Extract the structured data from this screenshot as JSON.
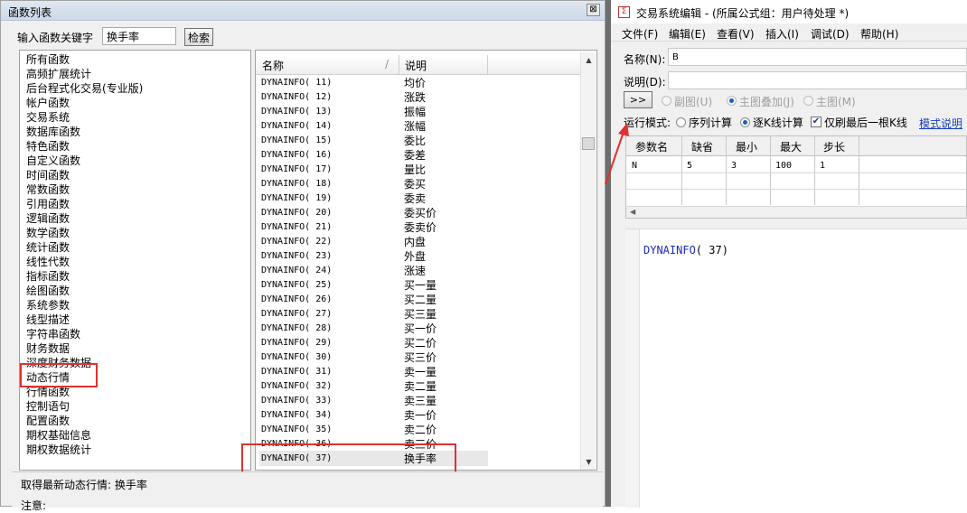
{
  "left": {
    "title": "函数列表",
    "close_label": "⊠",
    "search": {
      "label": "输入函数关键字",
      "value": "换手率",
      "button": "检索"
    },
    "categories": [
      "所有函数",
      "高频扩展统计",
      "后台程式化交易(专业版)",
      "帐户函数",
      "交易系统",
      "数据库函数",
      "特色函数",
      "自定义函数",
      "时间函数",
      "常数函数",
      "引用函数",
      "逻辑函数",
      "数学函数",
      "统计函数",
      "线性代数",
      "指标函数",
      "绘图函数",
      "系统参数",
      "线型描述",
      "字符串函数",
      "财务数据",
      "深度财务数据",
      "动态行情",
      "行情函数",
      "控制语句",
      "配置函数",
      "期权基础信息",
      "期权数据统计"
    ],
    "table": {
      "headers": {
        "name": "名称",
        "sort": "/",
        "desc": "说明"
      },
      "rows": [
        {
          "name": "DYNAINFO( 11)",
          "desc": "均价"
        },
        {
          "name": "DYNAINFO( 12)",
          "desc": "涨跌"
        },
        {
          "name": "DYNAINFO( 13)",
          "desc": "振幅"
        },
        {
          "name": "DYNAINFO( 14)",
          "desc": "涨幅"
        },
        {
          "name": "DYNAINFO( 15)",
          "desc": "委比"
        },
        {
          "name": "DYNAINFO( 16)",
          "desc": "委差"
        },
        {
          "name": "DYNAINFO( 17)",
          "desc": "量比"
        },
        {
          "name": "DYNAINFO( 18)",
          "desc": "委买"
        },
        {
          "name": "DYNAINFO( 19)",
          "desc": "委卖"
        },
        {
          "name": "DYNAINFO( 20)",
          "desc": "委买价"
        },
        {
          "name": "DYNAINFO( 21)",
          "desc": "委卖价"
        },
        {
          "name": "DYNAINFO( 22)",
          "desc": "内盘"
        },
        {
          "name": "DYNAINFO( 23)",
          "desc": "外盘"
        },
        {
          "name": "DYNAINFO( 24)",
          "desc": "涨速"
        },
        {
          "name": "DYNAINFO( 25)",
          "desc": "买一量"
        },
        {
          "name": "DYNAINFO( 26)",
          "desc": "买二量"
        },
        {
          "name": "DYNAINFO( 27)",
          "desc": "买三量"
        },
        {
          "name": "DYNAINFO( 28)",
          "desc": "买一价"
        },
        {
          "name": "DYNAINFO( 29)",
          "desc": "买二价"
        },
        {
          "name": "DYNAINFO( 30)",
          "desc": "买三价"
        },
        {
          "name": "DYNAINFO( 31)",
          "desc": "卖一量"
        },
        {
          "name": "DYNAINFO( 32)",
          "desc": "卖二量"
        },
        {
          "name": "DYNAINFO( 33)",
          "desc": "卖三量"
        },
        {
          "name": "DYNAINFO( 34)",
          "desc": "卖一价"
        },
        {
          "name": "DYNAINFO( 35)",
          "desc": "卖二价"
        },
        {
          "name": "DYNAINFO( 36)",
          "desc": "卖三价"
        },
        {
          "name": "DYNAINFO( 37)",
          "desc": "换手率"
        }
      ]
    },
    "description": {
      "line1": "取得最新动态行情: 换手率",
      "line2": "注意:"
    }
  },
  "right": {
    "title": "交易系统编辑 - (所属公式组：用户待处理 *)",
    "icon_glyph": "Σ",
    "menu": [
      "文件(F)",
      "编辑(E)",
      "查看(V)",
      "插入(I)",
      "调试(D)",
      "帮助(H)"
    ],
    "name_label": "名称(N):",
    "name_value": "B",
    "remark_label": "说明(D):",
    "remark_value": "",
    "expand_button": ">>",
    "display_options": [
      "副图(U)",
      "主图叠加(J)",
      "主图(M)"
    ],
    "run_mode_label": "运行模式:",
    "run_modes": [
      "序列计算",
      "逐K线计算"
    ],
    "last_bar_checkbox": "仅刷最后一根K线",
    "last_bar_checked": true,
    "mode_help_link": "模式说明",
    "param_headers": [
      "参数名",
      "缺省",
      "最小",
      "最大",
      "步长"
    ],
    "params": [
      [
        "N",
        "5",
        "3",
        "100",
        "1"
      ]
    ],
    "code": {
      "fn": "DYNAINFO",
      "args": "( 37)"
    }
  },
  "colors": {
    "highlight_box": "#e03030",
    "link": "#1a3fc0",
    "code_keyword": "#1a2cb8"
  }
}
